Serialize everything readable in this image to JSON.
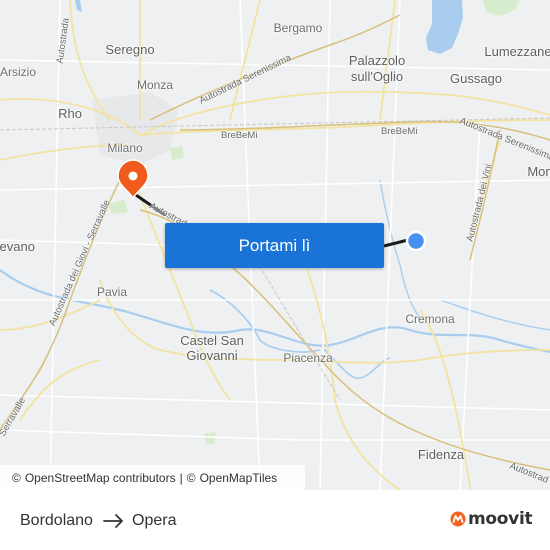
{
  "map": {
    "places": {
      "bergamo": "Bergamo",
      "seregno": "Seregno",
      "palazzolo": "Palazzolo",
      "sull_oglio": "sull'Oglio",
      "gussago": "Gussago",
      "lumezzane": "Lumezzane",
      "arsizio": "Arsizio",
      "monza": "Monza",
      "rho": "Rho",
      "milano": "Milano",
      "mon": "Mon",
      "cevano": "cevano",
      "pavia": "Pavia",
      "castel_san": "Castel San",
      "giovanni": "Giovanni",
      "piacenza": "Piacenza",
      "cremona": "Cremona",
      "fidenza": "Fidenza"
    },
    "roads": {
      "a_left_top": "Autostrada",
      "a_serenissima_top": "Autostrada Serenissima",
      "brebemi_1": "BreBeMi",
      "brebemi_2": "BreBeMi",
      "a_serenissima_right": "Autostrada Serenissima",
      "a_vini": "Autostrada dei Vini",
      "a_giovi": "Autostrada dei Giovi - Serravalle",
      "a_center": "Autostrada",
      "a_serravalle_bottom": "Serravalle",
      "a_bottom_right": "Autostrad"
    },
    "origin_marker": "blue-dot",
    "destination_marker": "orange-pin",
    "accent_color": "#1a73d6",
    "pin_color": "#f05a1a"
  },
  "cta": {
    "label": "Portami lì"
  },
  "attribution": {
    "osm_symbol": "©",
    "osm_label": "OpenStreetMap contributors",
    "separator": "|",
    "omt_symbol": "©",
    "omt_label": "OpenMapTiles"
  },
  "footer": {
    "from": "Bordolano",
    "to": "Opera",
    "arrow_icon": "arrow-right-icon",
    "brand": "moovit",
    "brand_color": "#f26522"
  }
}
